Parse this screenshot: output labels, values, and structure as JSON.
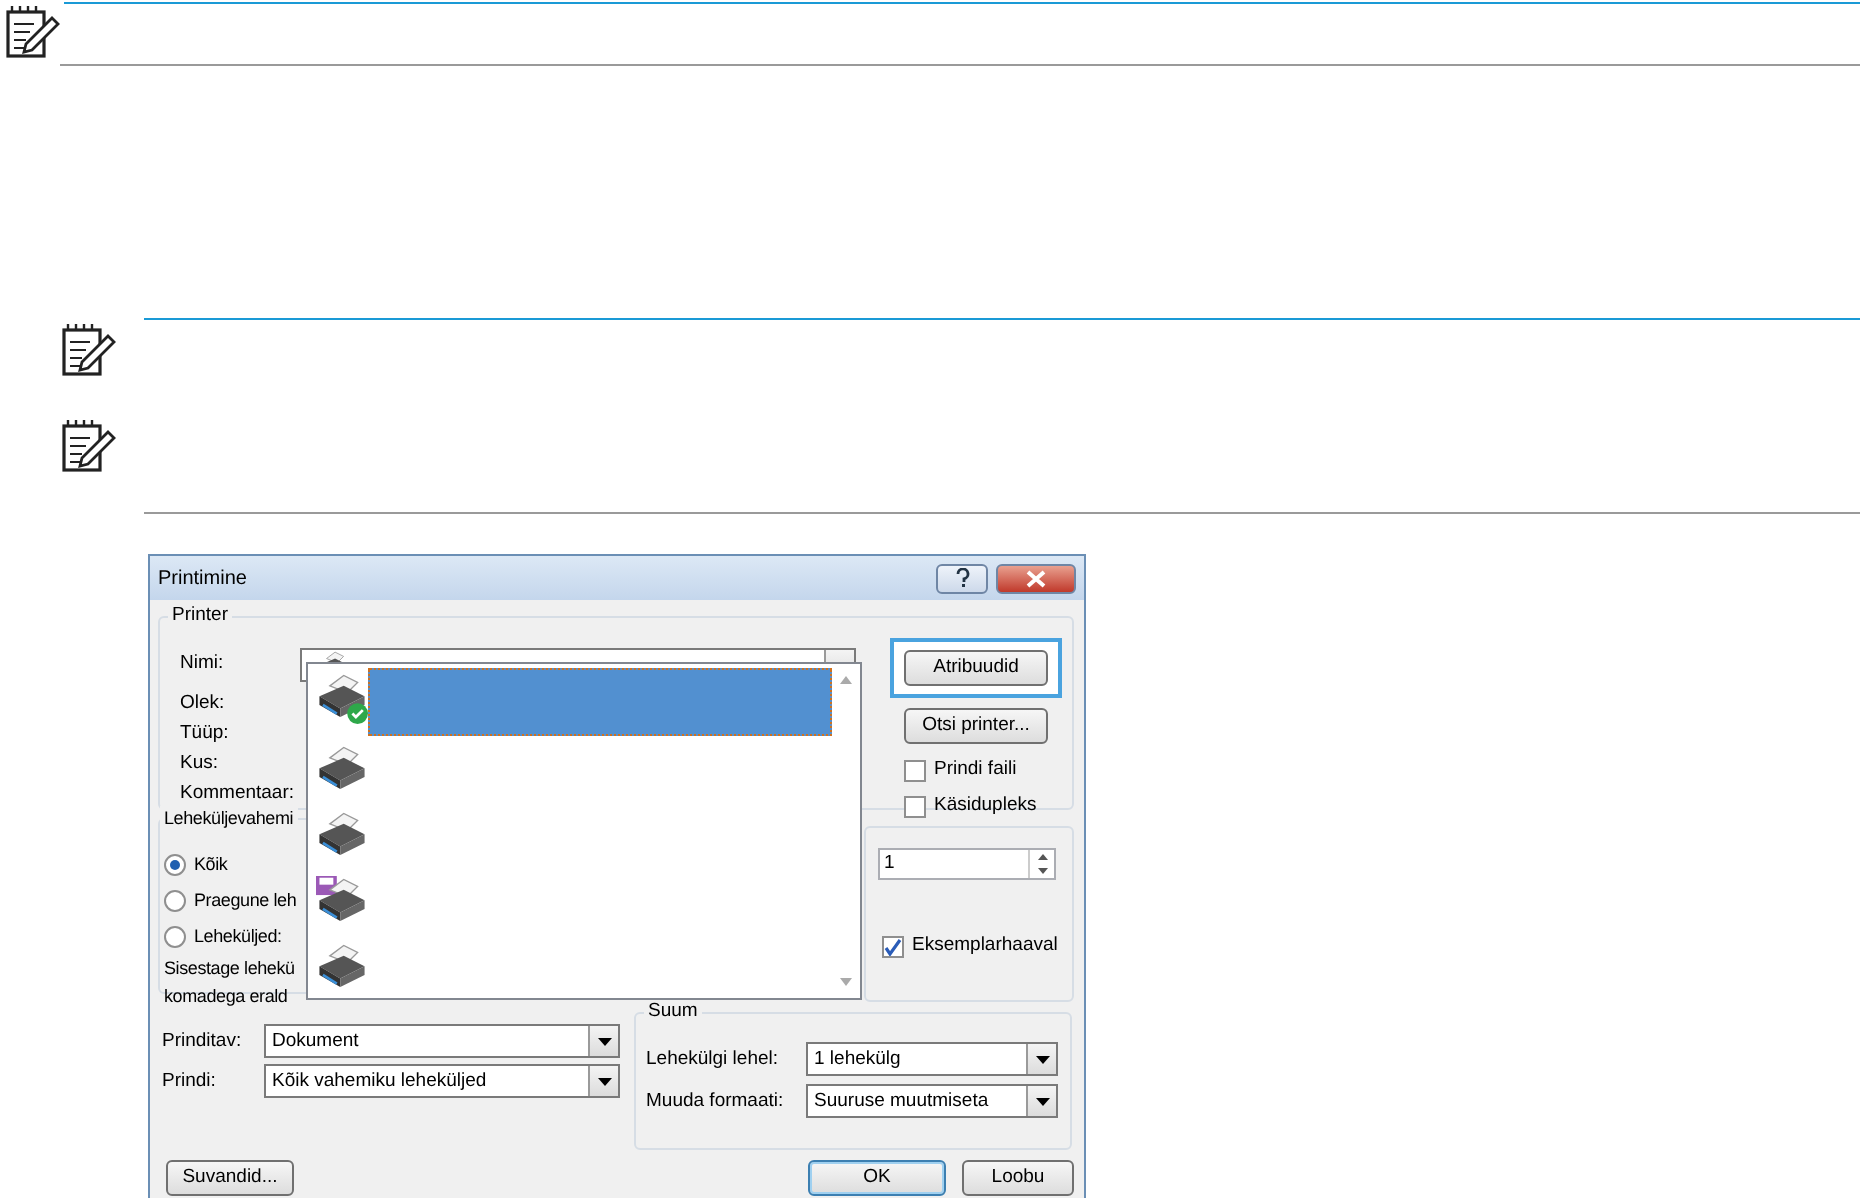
{
  "dialog": {
    "title": "Printimine",
    "printer": {
      "title": "Printer",
      "labels": [
        "Nimi:",
        "Olek:",
        "Tüüp:",
        "Kus:",
        "Kommentaar:"
      ],
      "items": [
        {
          "kind": "default",
          "selected": true
        },
        {
          "kind": "printer",
          "selected": false
        },
        {
          "kind": "printer",
          "selected": false
        },
        {
          "kind": "fax",
          "selected": false
        },
        {
          "kind": "printer",
          "selected": false
        }
      ],
      "buttons": [
        {
          "label": "Atribuudid",
          "focused": true
        },
        {
          "label": "Otsi printer...",
          "focused": false
        }
      ],
      "checkboxes": [
        {
          "label": "Prindi faili",
          "checked": false
        },
        {
          "label": "Käsidupleks",
          "checked": false
        }
      ]
    },
    "range": {
      "title": "Leheküljevahemi",
      "options": [
        {
          "label": "Kõik",
          "selected": true
        },
        {
          "label": "Praegune leh",
          "selected": false
        },
        {
          "label": "Leheküljed:",
          "selected": false
        }
      ],
      "hint": [
        "Sisestage lehekü",
        "komadega erald"
      ]
    },
    "copies": {
      "value": "1",
      "collate": {
        "label": "Eksemplarhaaval",
        "checked": true
      }
    },
    "print_what": [
      {
        "label": "Prinditav:",
        "value": "Dokument"
      },
      {
        "label": "Prindi:",
        "value": "Kõik vahemiku leheküljed"
      }
    ],
    "zoom": {
      "title": "Suum",
      "fields": [
        {
          "label": "Lehekülgi lehel:",
          "value": "1 lehekülg"
        },
        {
          "label": "Muuda formaati:",
          "value": "Suuruse muutmiseta"
        }
      ]
    },
    "footer_buttons": [
      {
        "label": "Suvandid...",
        "default": false
      },
      {
        "label": "OK",
        "default": true
      },
      {
        "label": "Loobu",
        "default": false
      }
    ]
  }
}
